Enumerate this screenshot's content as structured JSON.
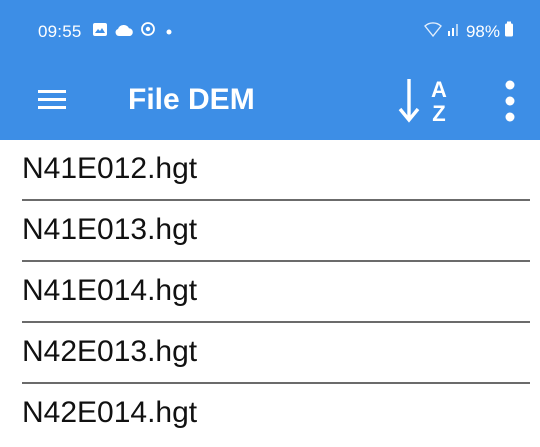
{
  "status_bar": {
    "time": "09:55",
    "battery": "98%",
    "icons": [
      "photo-notification-icon",
      "cloud-icon",
      "circle-status-icon",
      "dot-icon",
      "wifi-icon",
      "signal-icon",
      "battery-icon"
    ]
  },
  "app_bar": {
    "title": "File DEM",
    "sort_icon": "sort-alpha-icon",
    "sort_letters": [
      "A",
      "Z"
    ]
  },
  "files": [
    {
      "name": "N41E012.hgt"
    },
    {
      "name": "N41E013.hgt"
    },
    {
      "name": "N41E014.hgt"
    },
    {
      "name": "N42E013.hgt"
    },
    {
      "name": "N42E014.hgt"
    }
  ],
  "colors": {
    "app_bar": "#3d8ee6",
    "divider": "#6b6b6b",
    "text": "#111111"
  }
}
